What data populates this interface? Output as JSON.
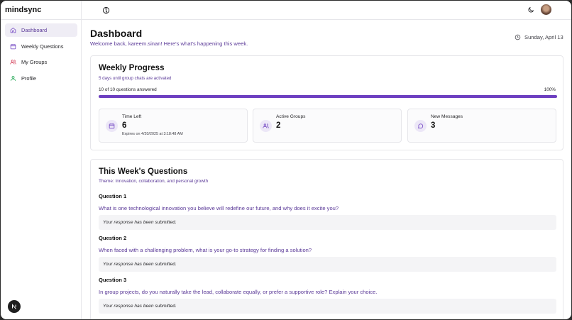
{
  "app": {
    "name": "mindsync"
  },
  "sidebar": {
    "items": [
      {
        "label": "Dashboard",
        "icon": "home-icon",
        "active": true
      },
      {
        "label": "Weekly Questions",
        "icon": "calendar-icon",
        "active": false
      },
      {
        "label": "My Groups",
        "icon": "users-icon",
        "active": false
      },
      {
        "label": "Profile",
        "icon": "user-icon",
        "active": false
      }
    ]
  },
  "header": {
    "title": "Dashboard",
    "subtitle": "Welcome back, kareem.sinan! Here's what's happening this week.",
    "date": "Sunday, April 13"
  },
  "progress": {
    "title": "Weekly Progress",
    "subtitle": "5 days until group chats are activated",
    "answered_label": "10 of 10 questions answered",
    "percent_label": "100%",
    "percent": 100,
    "stats": [
      {
        "label": "Time Left",
        "value": "6",
        "note": "Expires on 4/20/2025 at 3:18:48 AM",
        "icon": "calendar-icon"
      },
      {
        "label": "Active Groups",
        "value": "2",
        "note": "",
        "icon": "users-icon"
      },
      {
        "label": "New Messages",
        "value": "3",
        "note": "",
        "icon": "message-icon"
      }
    ]
  },
  "questions": {
    "title": "This Week's Questions",
    "theme": "Theme: Innovation, collaboration, and personal growth",
    "items": [
      {
        "title": "Question 1",
        "text": "What is one technological innovation you believe will redefine our future, and why does it excite you?",
        "response": "Your response has been submitted."
      },
      {
        "title": "Question 2",
        "text": "When faced with a challenging problem, what is your go-to strategy for finding a solution?",
        "response": "Your response has been submitted."
      },
      {
        "title": "Question 3",
        "text": "In group projects, do you naturally take the lead, collaborate equally, or prefer a supportive role? Explain your choice.",
        "response": "Your response has been submitted."
      }
    ]
  },
  "colors": {
    "accent": "#6d3fc0",
    "accent_text": "#5b3a98",
    "active_bg": "#efedf5"
  }
}
